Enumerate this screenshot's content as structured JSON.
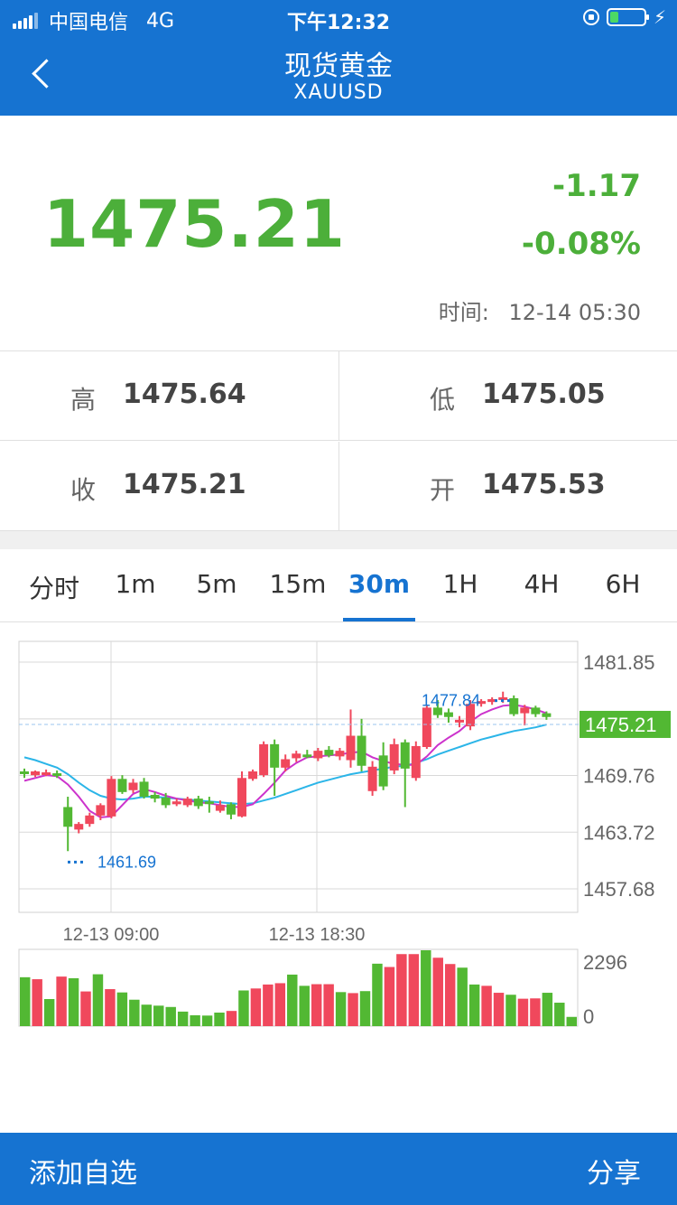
{
  "status_bar": {
    "carrier": "中国电信",
    "network": "4G",
    "time": "下午12:32",
    "battery_level": 0.25
  },
  "nav": {
    "title": "现货黄金",
    "subtitle": "XAUUSD",
    "back_icon": "chevron-left-icon"
  },
  "quote": {
    "price": "1475.21",
    "change": "-1.17",
    "change_pct": "-0.08%",
    "time_label": "时间:",
    "time_value": "12-14 05:30",
    "color": "#4caf3a"
  },
  "stats": [
    {
      "label": "高",
      "value": "1475.64"
    },
    {
      "label": "低",
      "value": "1475.05"
    },
    {
      "label": "收",
      "value": "1475.21"
    },
    {
      "label": "开",
      "value": "1475.53"
    }
  ],
  "tabs": {
    "items": [
      "分时",
      "1m",
      "5m",
      "15m",
      "30m",
      "1H",
      "4H",
      "6H"
    ],
    "active": "30m"
  },
  "chart_data": {
    "type": "candlestick",
    "y_ticks": [
      "1481.85",
      "1469.76",
      "1463.72",
      "1457.68"
    ],
    "ylim": [
      1457.68,
      1481.85
    ],
    "x_ticks": [
      {
        "label": "12-13 09:00",
        "index": 4
      },
      {
        "label": "12-13 18:30",
        "index": 13
      }
    ],
    "current_price_label": "1475.21",
    "current_price": 1475.21,
    "max_label": "1477.84",
    "max_value": 1477.84,
    "min_label": "1461.69",
    "min_value": 1461.69,
    "up_color": "#f0485c",
    "down_color": "#52b833",
    "ma_fast_color": "#cc33cc",
    "ma_slow_color": "#2bb5e8",
    "candles": [
      {
        "o": 1470.0,
        "c": 1470.2,
        "h": 1470.5,
        "l": 1469.5,
        "dir": "down"
      },
      {
        "o": 1470.2,
        "c": 1469.8,
        "h": 1470.3,
        "l": 1469.6,
        "dir": "up"
      },
      {
        "o": 1470.1,
        "c": 1469.9,
        "h": 1470.4,
        "l": 1469.7,
        "dir": "up"
      },
      {
        "o": 1470.0,
        "c": 1469.8,
        "h": 1470.3,
        "l": 1469.5,
        "dir": "down"
      },
      {
        "o": 1466.4,
        "c": 1464.3,
        "h": 1467.5,
        "l": 1461.7,
        "dir": "down"
      },
      {
        "o": 1464.0,
        "c": 1464.6,
        "h": 1464.8,
        "l": 1463.6,
        "dir": "up"
      },
      {
        "o": 1464.6,
        "c": 1465.5,
        "h": 1465.8,
        "l": 1464.3,
        "dir": "up"
      },
      {
        "o": 1465.5,
        "c": 1466.6,
        "h": 1466.8,
        "l": 1465.0,
        "dir": "up"
      },
      {
        "o": 1465.4,
        "c": 1469.4,
        "h": 1469.7,
        "l": 1465.2,
        "dir": "up"
      },
      {
        "o": 1469.4,
        "c": 1468.0,
        "h": 1469.8,
        "l": 1467.8,
        "dir": "down"
      },
      {
        "o": 1468.2,
        "c": 1469.0,
        "h": 1469.4,
        "l": 1467.9,
        "dir": "up"
      },
      {
        "o": 1469.1,
        "c": 1467.5,
        "h": 1469.5,
        "l": 1467.3,
        "dir": "down"
      },
      {
        "o": 1467.7,
        "c": 1467.3,
        "h": 1468.0,
        "l": 1466.9,
        "dir": "down"
      },
      {
        "o": 1467.4,
        "c": 1466.6,
        "h": 1467.9,
        "l": 1466.3,
        "dir": "down"
      },
      {
        "o": 1466.7,
        "c": 1467.0,
        "h": 1467.3,
        "l": 1466.5,
        "dir": "up"
      },
      {
        "o": 1467.3,
        "c": 1466.6,
        "h": 1467.5,
        "l": 1466.4,
        "dir": "up"
      },
      {
        "o": 1466.5,
        "c": 1467.3,
        "h": 1467.6,
        "l": 1466.2,
        "dir": "down"
      },
      {
        "o": 1466.8,
        "c": 1467.0,
        "h": 1467.5,
        "l": 1465.8,
        "dir": "down"
      },
      {
        "o": 1466.6,
        "c": 1466.0,
        "h": 1467.1,
        "l": 1465.8,
        "dir": "up"
      },
      {
        "o": 1466.7,
        "c": 1465.6,
        "h": 1466.9,
        "l": 1465.1,
        "dir": "down"
      },
      {
        "o": 1465.4,
        "c": 1469.5,
        "h": 1470.2,
        "l": 1465.3,
        "dir": "up"
      },
      {
        "o": 1469.4,
        "c": 1470.2,
        "h": 1470.4,
        "l": 1469.2,
        "dir": "up"
      },
      {
        "o": 1469.8,
        "c": 1473.1,
        "h": 1473.4,
        "l": 1469.6,
        "dir": "up"
      },
      {
        "o": 1473.1,
        "c": 1470.6,
        "h": 1473.6,
        "l": 1467.6,
        "dir": "down"
      },
      {
        "o": 1470.6,
        "c": 1471.5,
        "h": 1472.0,
        "l": 1470.2,
        "dir": "up"
      },
      {
        "o": 1471.6,
        "c": 1472.1,
        "h": 1472.4,
        "l": 1471.2,
        "dir": "up"
      },
      {
        "o": 1472.0,
        "c": 1471.8,
        "h": 1472.5,
        "l": 1471.6,
        "dir": "down"
      },
      {
        "o": 1471.6,
        "c": 1472.4,
        "h": 1472.7,
        "l": 1471.3,
        "dir": "up"
      },
      {
        "o": 1472.5,
        "c": 1471.9,
        "h": 1472.9,
        "l": 1471.7,
        "dir": "down"
      },
      {
        "o": 1471.8,
        "c": 1472.4,
        "h": 1472.7,
        "l": 1471.4,
        "dir": "up"
      },
      {
        "o": 1471.4,
        "c": 1474.0,
        "h": 1476.8,
        "l": 1470.6,
        "dir": "up"
      },
      {
        "o": 1474.0,
        "c": 1470.8,
        "h": 1475.8,
        "l": 1470.2,
        "dir": "down"
      },
      {
        "o": 1470.7,
        "c": 1468.1,
        "h": 1471.3,
        "l": 1467.6,
        "dir": "up"
      },
      {
        "o": 1468.6,
        "c": 1471.9,
        "h": 1473.3,
        "l": 1468.2,
        "dir": "down"
      },
      {
        "o": 1470.3,
        "c": 1473.1,
        "h": 1473.7,
        "l": 1469.9,
        "dir": "up"
      },
      {
        "o": 1473.3,
        "c": 1470.5,
        "h": 1473.6,
        "l": 1466.4,
        "dir": "down"
      },
      {
        "o": 1469.5,
        "c": 1472.9,
        "h": 1473.4,
        "l": 1469.2,
        "dir": "up"
      },
      {
        "o": 1472.8,
        "c": 1477.0,
        "h": 1477.3,
        "l": 1472.6,
        "dir": "up"
      },
      {
        "o": 1477.0,
        "c": 1476.2,
        "h": 1477.8,
        "l": 1475.9,
        "dir": "down"
      },
      {
        "o": 1476.5,
        "c": 1476.0,
        "h": 1476.9,
        "l": 1475.4,
        "dir": "down"
      },
      {
        "o": 1475.5,
        "c": 1475.7,
        "h": 1476.1,
        "l": 1474.9,
        "dir": "up"
      },
      {
        "o": 1475.0,
        "c": 1477.4,
        "h": 1477.8,
        "l": 1474.6,
        "dir": "up"
      },
      {
        "o": 1477.4,
        "c": 1477.7,
        "h": 1477.9,
        "l": 1477.1,
        "dir": "up"
      },
      {
        "o": 1477.6,
        "c": 1477.9,
        "h": 1478.1,
        "l": 1477.3,
        "dir": "up"
      },
      {
        "o": 1477.9,
        "c": 1478.1,
        "h": 1478.7,
        "l": 1477.5,
        "dir": "up"
      },
      {
        "o": 1478.0,
        "c": 1476.3,
        "h": 1478.3,
        "l": 1476.1,
        "dir": "down"
      },
      {
        "o": 1476.4,
        "c": 1477.0,
        "h": 1477.3,
        "l": 1475.1,
        "dir": "up"
      },
      {
        "o": 1477.0,
        "c": 1476.3,
        "h": 1477.2,
        "l": 1476.0,
        "dir": "down"
      },
      {
        "o": 1476.4,
        "c": 1476.0,
        "h": 1476.6,
        "l": 1475.7,
        "dir": "down"
      }
    ],
    "ma_fast": [
      1469.2,
      1469.5,
      1469.8,
      1469.7,
      1468.8,
      1467.5,
      1466.0,
      1465.3,
      1465.4,
      1466.6,
      1467.8,
      1468.3,
      1468.0,
      1467.6,
      1467.3,
      1467.1,
      1466.9,
      1466.8,
      1466.6,
      1466.4,
      1466.4,
      1466.7,
      1467.8,
      1469.0,
      1470.3,
      1471.1,
      1471.7,
      1471.8,
      1471.9,
      1472.0,
      1472.2,
      1472.3,
      1471.7,
      1471.3,
      1471.0,
      1470.9,
      1470.9,
      1471.8,
      1473.0,
      1473.8,
      1474.5,
      1475.5,
      1476.3,
      1476.8,
      1477.2,
      1477.3,
      1477.1,
      1476.8,
      1476.4
    ],
    "ma_slow": [
      1471.7,
      1471.4,
      1471.0,
      1470.6,
      1469.9,
      1469.0,
      1468.2,
      1467.6,
      1467.3,
      1467.2,
      1467.3,
      1467.5,
      1467.5,
      1467.4,
      1467.3,
      1467.2,
      1467.1,
      1467.0,
      1466.9,
      1466.8,
      1466.7,
      1466.8,
      1467.1,
      1467.4,
      1467.8,
      1468.2,
      1468.6,
      1469.0,
      1469.3,
      1469.6,
      1469.9,
      1470.1,
      1470.3,
      1470.5,
      1470.7,
      1470.8,
      1471.1,
      1471.5,
      1472.0,
      1472.4,
      1472.8,
      1473.2,
      1473.6,
      1473.9,
      1474.2,
      1474.5,
      1474.7,
      1474.9,
      1475.2
    ],
    "volume_ticks": [
      "2296",
      "0"
    ],
    "volume_max": 2296,
    "volumes": [
      1480,
      1420,
      820,
      1500,
      1450,
      1050,
      1570,
      1120,
      1020,
      800,
      650,
      620,
      580,
      440,
      330,
      320,
      410,
      460,
      1080,
      1140,
      1260,
      1300,
      1560,
      1220,
      1270,
      1270,
      1030,
      1000,
      1060,
      1890,
      1790,
      2180,
      2180,
      2296,
      2070,
      1880,
      1770,
      1260,
      1220,
      1010,
      950,
      830,
      840,
      1010,
      710,
      280
    ],
    "volume_dirs": [
      "down",
      "up",
      "down",
      "up",
      "down",
      "up",
      "down",
      "up",
      "down",
      "down",
      "down",
      "down",
      "down",
      "down",
      "down",
      "down",
      "down",
      "up",
      "down",
      "up",
      "up",
      "up",
      "down",
      "down",
      "up",
      "up",
      "down",
      "up",
      "down",
      "down",
      "up",
      "up",
      "up",
      "down",
      "up",
      "up",
      "down",
      "down",
      "up",
      "up",
      "down",
      "up",
      "up",
      "down",
      "down",
      "down"
    ]
  },
  "bottom": {
    "add_label": "添加自选",
    "share_label": "分享"
  }
}
